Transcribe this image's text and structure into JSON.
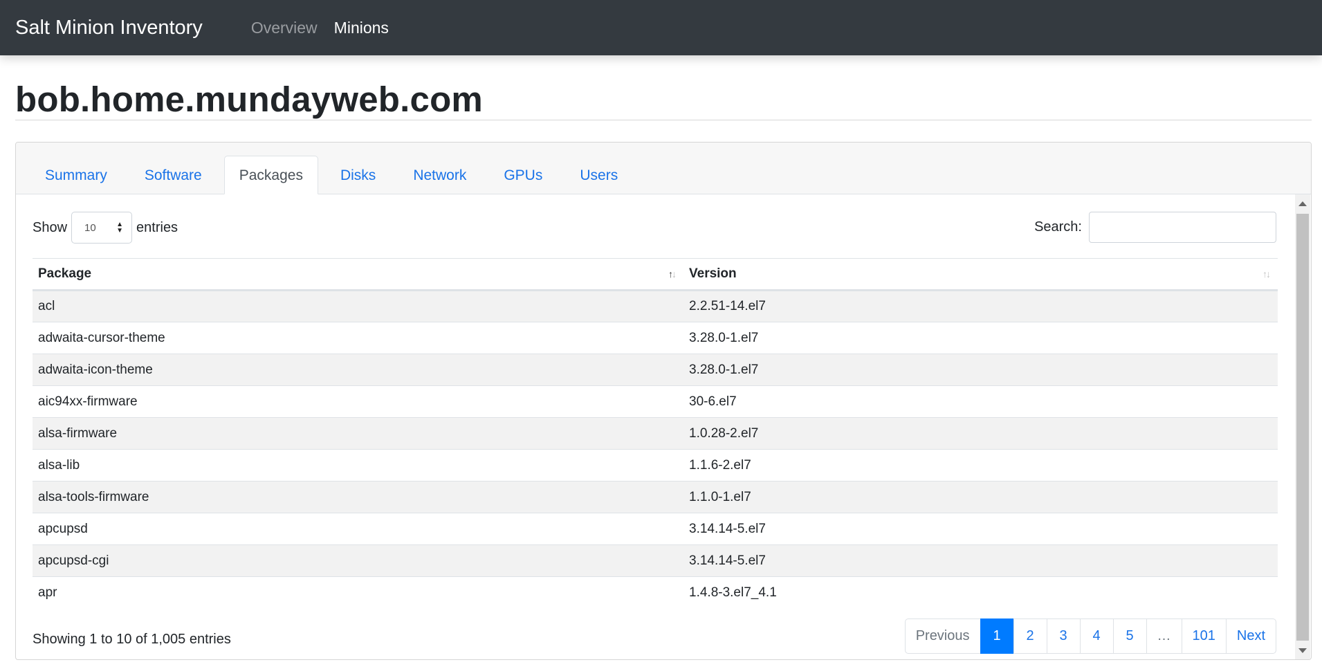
{
  "navbar": {
    "brand": "Salt Minion Inventory",
    "links": [
      "Overview",
      "Minions"
    ]
  },
  "page": {
    "title": "bob.home.mundayweb.com"
  },
  "tabs": [
    "Summary",
    "Software",
    "Packages",
    "Disks",
    "Network",
    "GPUs",
    "Users"
  ],
  "active_tab": "Packages",
  "controls": {
    "show_label": "Show",
    "page_size": "10",
    "entries_label": "entries",
    "search_label": "Search:",
    "search_value": ""
  },
  "table": {
    "columns": [
      "Package",
      "Version"
    ],
    "rows": [
      [
        "acl",
        "2.2.51-14.el7"
      ],
      [
        "adwaita-cursor-theme",
        "3.28.0-1.el7"
      ],
      [
        "adwaita-icon-theme",
        "3.28.0-1.el7"
      ],
      [
        "aic94xx-firmware",
        "30-6.el7"
      ],
      [
        "alsa-firmware",
        "1.0.28-2.el7"
      ],
      [
        "alsa-lib",
        "1.1.6-2.el7"
      ],
      [
        "alsa-tools-firmware",
        "1.1.0-1.el7"
      ],
      [
        "apcupsd",
        "3.14.14-5.el7"
      ],
      [
        "apcupsd-cgi",
        "3.14.14-5.el7"
      ],
      [
        "apr",
        "1.4.8-3.el7_4.1"
      ]
    ]
  },
  "info": "Showing 1 to 10 of 1,005 entries",
  "pagination": {
    "previous": "Previous",
    "pages": [
      "1",
      "2",
      "3",
      "4",
      "5",
      "…",
      "101"
    ],
    "next": "Next",
    "current": "1"
  },
  "colors": {
    "navbar_bg": "#343a40",
    "link": "#1a73e8",
    "accent": "#007bff",
    "stripe": "#f2f2f2"
  },
  "icons": [
    "sort-both-icon",
    "select-arrows-icon",
    "scroll-up-icon",
    "scroll-down-icon"
  ]
}
